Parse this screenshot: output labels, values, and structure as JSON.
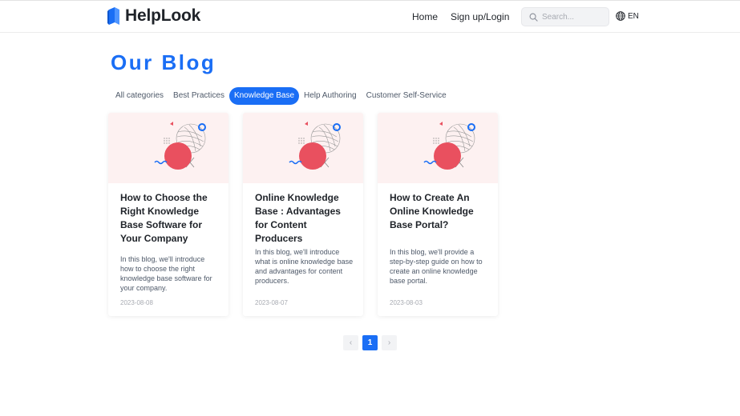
{
  "header": {
    "brand": "HelpLook",
    "nav_home": "Home",
    "nav_login": "Sign up/Login",
    "search_placeholder": "Search...",
    "lang": "EN"
  },
  "page": {
    "title": "Our Blog"
  },
  "categories": [
    {
      "label": "All categories",
      "active": false
    },
    {
      "label": "Best Practices",
      "active": false
    },
    {
      "label": "Knowledge Base",
      "active": true
    },
    {
      "label": "Help Authoring",
      "active": false
    },
    {
      "label": "Customer Self-Service",
      "active": false
    }
  ],
  "posts": [
    {
      "title": "How to Choose the Right Knowledge Base Software for Your Company",
      "excerpt": "In this blog, we'll introduce how to choose the right knowledge base software for your company.",
      "date": "2023-08-08"
    },
    {
      "title": "Online Knowledge Base : Advantages for Content Producers",
      "excerpt": "In this blog, we'll introduce what is online knowledge base and advantages for content producers.",
      "date": "2023-08-07"
    },
    {
      "title": "How to Create An Online Knowledge Base Portal?",
      "excerpt": "In this blog, we'll provide a step-by-step guide on how to create an online knowledge base portal.",
      "date": "2023-08-03"
    }
  ],
  "pagination": {
    "prev": "‹",
    "current": "1",
    "next": "›"
  },
  "colors": {
    "accent": "#1a6ef5",
    "thumb_bg": "#fdf1f1",
    "illustration_red": "#e9505f"
  }
}
